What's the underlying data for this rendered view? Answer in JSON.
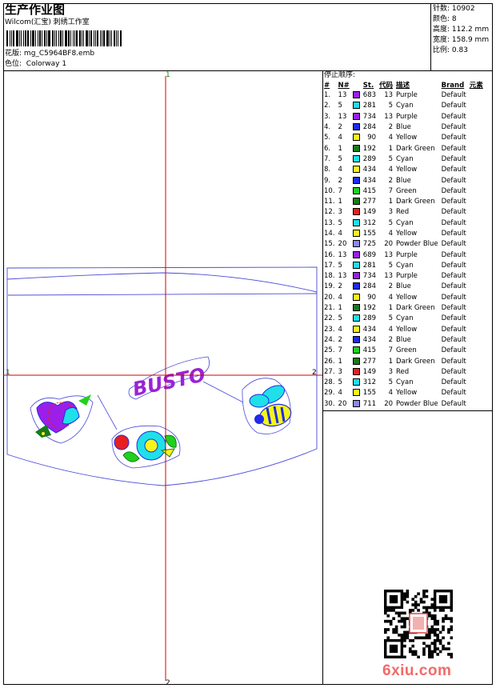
{
  "header": {
    "title": "生产作业图",
    "company": "Wilcom(汇宝) 刺绣工作室",
    "file_label": "花版:",
    "file_name": "mg_C5964BF8.emb",
    "color_label": "色位:",
    "colorway": "Colorway 1"
  },
  "stats": [
    {
      "label": "针数:",
      "value": "10902"
    },
    {
      "label": "颜色:",
      "value": "8"
    },
    {
      "label": "高度:",
      "value": "112.2 mm"
    },
    {
      "label": "宽度:",
      "value": "158.9 mm"
    },
    {
      "label": "比例:",
      "value": "0.83"
    }
  ],
  "design": {
    "text": "BUSTO",
    "axis_labels": {
      "top": "1",
      "bottom": "2",
      "left": "1",
      "right": "2"
    },
    "colors": {
      "axis": "#d40000",
      "outline": "#4a4ad8",
      "text": "#9a22d8"
    }
  },
  "stop_table": {
    "title": "停止顺序:",
    "headers": {
      "n": "#",
      "needle": "N#",
      "st": "St.",
      "code": "代码",
      "desc": "描述",
      "brand": "Brand",
      "elem": "元素"
    },
    "rows": [
      {
        "n": "1.",
        "needle": "13",
        "color": "#9b1fe8",
        "st": "683",
        "code": "13",
        "desc": "Purple",
        "brand": "Default"
      },
      {
        "n": "2.",
        "needle": "5",
        "color": "#1fe0e8",
        "st": "281",
        "code": "5",
        "desc": "Cyan",
        "brand": "Default"
      },
      {
        "n": "3.",
        "needle": "13",
        "color": "#9b1fe8",
        "st": "734",
        "code": "13",
        "desc": "Purple",
        "brand": "Default"
      },
      {
        "n": "4.",
        "needle": "2",
        "color": "#1f2be8",
        "st": "284",
        "code": "2",
        "desc": "Blue",
        "brand": "Default"
      },
      {
        "n": "5.",
        "needle": "4",
        "color": "#f5f51a",
        "st": "90",
        "code": "4",
        "desc": "Yellow",
        "brand": "Default"
      },
      {
        "n": "6.",
        "needle": "1",
        "color": "#1a7a1a",
        "st": "192",
        "code": "1",
        "desc": "Dark Green",
        "brand": "Default"
      },
      {
        "n": "7.",
        "needle": "5",
        "color": "#1fe0e8",
        "st": "289",
        "code": "5",
        "desc": "Cyan",
        "brand": "Default"
      },
      {
        "n": "8.",
        "needle": "4",
        "color": "#f5f51a",
        "st": "434",
        "code": "4",
        "desc": "Yellow",
        "brand": "Default"
      },
      {
        "n": "9.",
        "needle": "2",
        "color": "#1f2be8",
        "st": "434",
        "code": "2",
        "desc": "Blue",
        "brand": "Default"
      },
      {
        "n": "10.",
        "needle": "7",
        "color": "#1fd11f",
        "st": "415",
        "code": "7",
        "desc": "Green",
        "brand": "Default"
      },
      {
        "n": "11.",
        "needle": "1",
        "color": "#1a7a1a",
        "st": "277",
        "code": "1",
        "desc": "Dark Green",
        "brand": "Default"
      },
      {
        "n": "12.",
        "needle": "3",
        "color": "#e81f1f",
        "st": "149",
        "code": "3",
        "desc": "Red",
        "brand": "Default"
      },
      {
        "n": "13.",
        "needle": "5",
        "color": "#1fe0e8",
        "st": "312",
        "code": "5",
        "desc": "Cyan",
        "brand": "Default"
      },
      {
        "n": "14.",
        "needle": "4",
        "color": "#f5f51a",
        "st": "155",
        "code": "4",
        "desc": "Yellow",
        "brand": "Default"
      },
      {
        "n": "15.",
        "needle": "20",
        "color": "#8a8ae8",
        "st": "725",
        "code": "20",
        "desc": "Powder Blue",
        "brand": "Default"
      },
      {
        "n": "16.",
        "needle": "13",
        "color": "#9b1fe8",
        "st": "689",
        "code": "13",
        "desc": "Purple",
        "brand": "Default"
      },
      {
        "n": "17.",
        "needle": "5",
        "color": "#1fe0e8",
        "st": "281",
        "code": "5",
        "desc": "Cyan",
        "brand": "Default"
      },
      {
        "n": "18.",
        "needle": "13",
        "color": "#9b1fe8",
        "st": "734",
        "code": "13",
        "desc": "Purple",
        "brand": "Default"
      },
      {
        "n": "19.",
        "needle": "2",
        "color": "#1f2be8",
        "st": "284",
        "code": "2",
        "desc": "Blue",
        "brand": "Default"
      },
      {
        "n": "20.",
        "needle": "4",
        "color": "#f5f51a",
        "st": "90",
        "code": "4",
        "desc": "Yellow",
        "brand": "Default"
      },
      {
        "n": "21.",
        "needle": "1",
        "color": "#1a7a1a",
        "st": "192",
        "code": "1",
        "desc": "Dark Green",
        "brand": "Default"
      },
      {
        "n": "22.",
        "needle": "5",
        "color": "#1fe0e8",
        "st": "289",
        "code": "5",
        "desc": "Cyan",
        "brand": "Default"
      },
      {
        "n": "23.",
        "needle": "4",
        "color": "#f5f51a",
        "st": "434",
        "code": "4",
        "desc": "Yellow",
        "brand": "Default"
      },
      {
        "n": "24.",
        "needle": "2",
        "color": "#1f2be8",
        "st": "434",
        "code": "2",
        "desc": "Blue",
        "brand": "Default"
      },
      {
        "n": "25.",
        "needle": "7",
        "color": "#1fd11f",
        "st": "415",
        "code": "7",
        "desc": "Green",
        "brand": "Default"
      },
      {
        "n": "26.",
        "needle": "1",
        "color": "#1a7a1a",
        "st": "277",
        "code": "1",
        "desc": "Dark Green",
        "brand": "Default"
      },
      {
        "n": "27.",
        "needle": "3",
        "color": "#e81f1f",
        "st": "149",
        "code": "3",
        "desc": "Red",
        "brand": "Default"
      },
      {
        "n": "28.",
        "needle": "5",
        "color": "#1fe0e8",
        "st": "312",
        "code": "5",
        "desc": "Cyan",
        "brand": "Default"
      },
      {
        "n": "29.",
        "needle": "4",
        "color": "#f5f51a",
        "st": "155",
        "code": "4",
        "desc": "Yellow",
        "brand": "Default"
      },
      {
        "n": "30.",
        "needle": "20",
        "color": "#8a8ae8",
        "st": "711",
        "code": "20",
        "desc": "Powder Blue",
        "brand": "Default"
      }
    ]
  },
  "watermark": "6xiu.com",
  "icons": {
    "qr": "qr-code-icon",
    "barcode": "barcode-icon"
  }
}
